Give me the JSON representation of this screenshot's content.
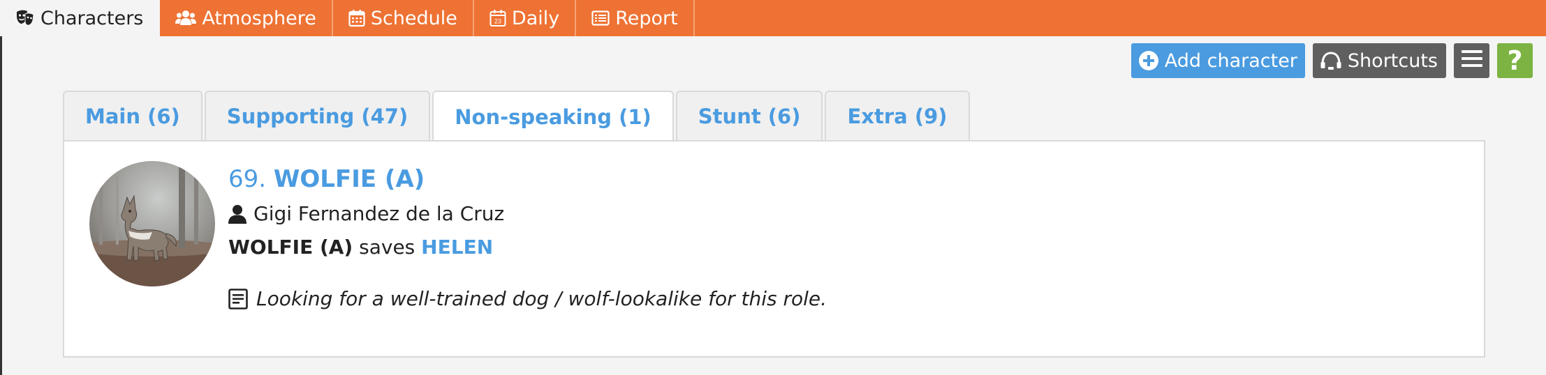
{
  "nav": {
    "items": [
      {
        "label": "Characters",
        "icon": "theater-masks-icon"
      },
      {
        "label": "Atmosphere",
        "icon": "users-icon"
      },
      {
        "label": "Schedule",
        "icon": "calendar-icon"
      },
      {
        "label": "Daily",
        "icon": "calendar-day-icon",
        "icon_text": "23"
      },
      {
        "label": "Report",
        "icon": "list-alt-icon"
      }
    ],
    "active": "Characters"
  },
  "toolbar": {
    "add_label": "Add character",
    "shortcuts_label": "Shortcuts",
    "help_label": "?"
  },
  "tabs": [
    {
      "label": "Main (6)"
    },
    {
      "label": "Supporting (47)"
    },
    {
      "label": "Non-speaking (1)"
    },
    {
      "label": "Stunt (6)"
    },
    {
      "label": "Extra (9)"
    }
  ],
  "active_tab": "Non-speaking (1)",
  "character": {
    "number": "69.",
    "name": "WOLFIE (A)",
    "actor": "Gigi Fernandez de la Cruz",
    "relation": {
      "subject": "WOLFIE (A)",
      "verb": "saves",
      "object": "HELEN"
    },
    "note": "Looking for a well-trained dog / wolf-lookalike for this role."
  },
  "colors": {
    "nav_bg": "#ee7233",
    "accent_blue": "#4a9be0",
    "dark_button": "#5f5f5f",
    "help_green": "#7cb342"
  }
}
